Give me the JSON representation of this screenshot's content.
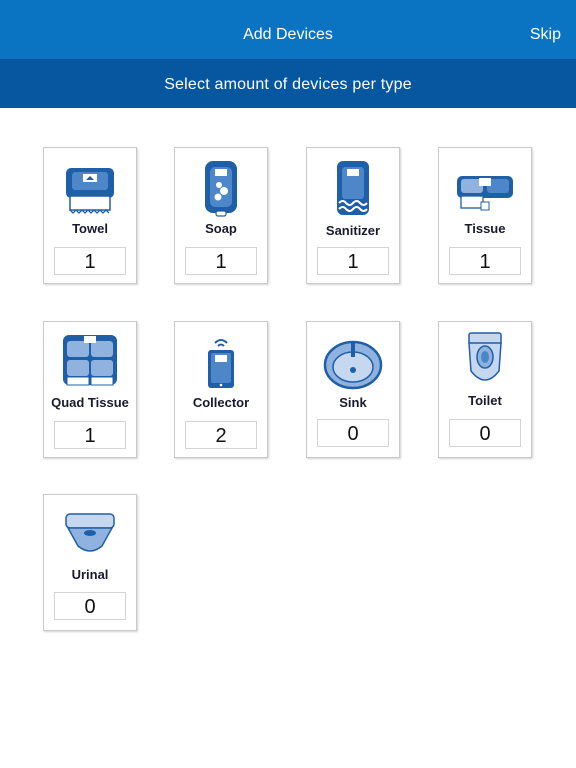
{
  "header": {
    "title": "Add Devices",
    "skip_label": "Skip"
  },
  "subheader": {
    "text": "Select amount of devices per type"
  },
  "devices": [
    {
      "label": "Towel",
      "count": "1",
      "icon": "towel-dispenser-icon"
    },
    {
      "label": "Soap",
      "count": "1",
      "icon": "soap-dispenser-icon"
    },
    {
      "label": "Sanitizer",
      "count": "1",
      "icon": "sanitizer-dispenser-icon"
    },
    {
      "label": "Tissue",
      "count": "1",
      "icon": "tissue-dispenser-icon"
    },
    {
      "label": "Quad Tissue",
      "count": "1",
      "icon": "quad-tissue-dispenser-icon"
    },
    {
      "label": "Collector",
      "count": "2",
      "icon": "collector-device-icon"
    },
    {
      "label": "Sink",
      "count": "0",
      "icon": "sink-icon"
    },
    {
      "label": "Toilet",
      "count": "0",
      "icon": "toilet-icon"
    },
    {
      "label": "Urinal",
      "count": "0",
      "icon": "urinal-icon"
    }
  ],
  "colors": {
    "header": "#0a73c2",
    "subheader": "#0656a0",
    "icon_blue": "#1f5fa8",
    "icon_light": "#8fb2de"
  }
}
